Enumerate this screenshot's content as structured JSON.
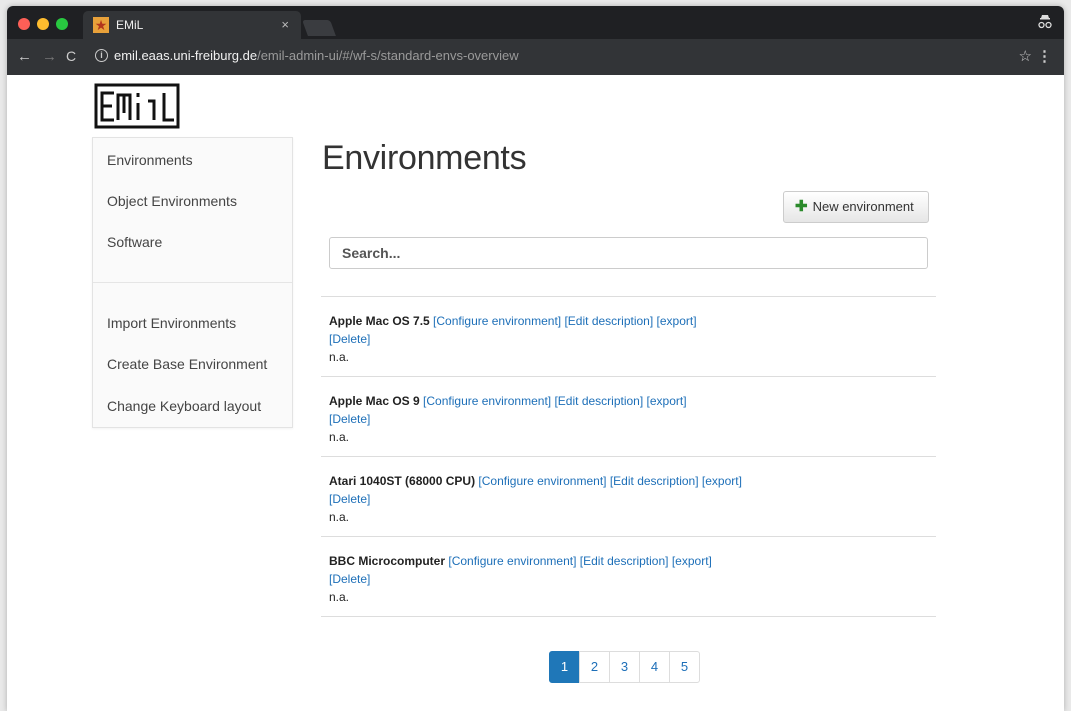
{
  "browser": {
    "tab_title": "EMiL",
    "tab_close": "×",
    "url_host": "emil.eaas.uni-freiburg.de",
    "url_path": "/emil-admin-ui/#/wf-s/standard-envs-overview"
  },
  "logo_text": "EMiL",
  "sidebar": {
    "items": [
      {
        "label": "Environments"
      },
      {
        "label": "Object Environments"
      },
      {
        "label": "Software"
      },
      {
        "label": "Import Environments"
      },
      {
        "label": "Create Base Environment"
      },
      {
        "label": "Change Keyboard layout"
      }
    ]
  },
  "main": {
    "title": "Environments",
    "new_button": "New environment",
    "search_placeholder": "Search...",
    "environments": [
      {
        "name": "Apple Mac OS 7.5",
        "configure": "[Configure environment]",
        "edit": "[Edit description]",
        "export": "[export]",
        "delete": "[Delete]",
        "description": "n.a."
      },
      {
        "name": "Apple Mac OS 9",
        "configure": "[Configure environment]",
        "edit": "[Edit description]",
        "export": "[export]",
        "delete": "[Delete]",
        "description": "n.a."
      },
      {
        "name": "Atari 1040ST (68000 CPU)",
        "configure": "[Configure environment]",
        "edit": "[Edit description]",
        "export": "[export]",
        "delete": "[Delete]",
        "description": "n.a."
      },
      {
        "name": "BBC Microcomputer",
        "configure": "[Configure environment]",
        "edit": "[Edit description]",
        "export": "[export]",
        "delete": "[Delete]",
        "description": "n.a."
      }
    ]
  },
  "pagination": {
    "pages": [
      "1",
      "2",
      "3",
      "4",
      "5"
    ],
    "active": "1"
  },
  "colors": {
    "link": "#1d6fb8",
    "active_page": "#1f77b8"
  }
}
